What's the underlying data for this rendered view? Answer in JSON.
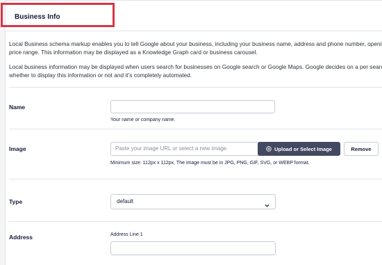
{
  "header": {
    "title": "Business Info"
  },
  "description": {
    "p1_line1": "Local Business schema markup enables you to tell Google about your business, including your business name, address and phone number, opening",
    "p1_line2": "price range. This information may be displayed as a Knowledge Graph card or business carousel.",
    "p2_line1": "Local business information may be displayed when users search for businesses on Google search or Google Maps. Google decides on a per search b",
    "p2_line2": "whether to display this information or not and it’s completely automated."
  },
  "name_field": {
    "label": "Name",
    "value": "",
    "help": "Your name or company name."
  },
  "image_field": {
    "label": "Image",
    "placeholder": "Paste your image URL or select a new image",
    "upload_label": "Upload or Select Image",
    "remove_label": "Remove",
    "help": "Minimum size: 112px x 112px, The image must be in JPG, PNG, GIF, SVG, or WEBP format."
  },
  "type_field": {
    "label": "Type",
    "selected": "default"
  },
  "address_field": {
    "label": "Address",
    "line1_label": "Address Line 1",
    "line1_value": ""
  },
  "icons": {
    "upload": "plus-circle-icon",
    "dropdown": "chevron-down-icon"
  },
  "colors": {
    "highlight": "#d63649",
    "button_dark": "#434960"
  }
}
